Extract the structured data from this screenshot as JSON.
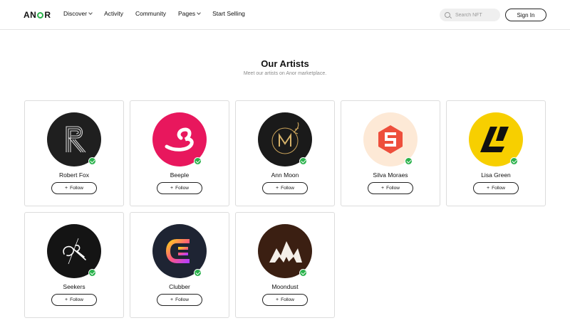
{
  "header": {
    "logo_text_pre": "AN",
    "logo_text_post": "R",
    "nav": [
      {
        "label": "Discover",
        "has_dropdown": true
      },
      {
        "label": "Activity",
        "has_dropdown": false
      },
      {
        "label": "Community",
        "has_dropdown": false
      },
      {
        "label": "Pages",
        "has_dropdown": true
      },
      {
        "label": "Start Selling",
        "has_dropdown": false
      }
    ],
    "search_placeholder": "Search NFT",
    "signin_label": "Sign In",
    "accent_color": "#2bb24c"
  },
  "section": {
    "title": "Our Artists",
    "subtitle": "Meet our artists on Anor marketplace."
  },
  "follow_label": "Follow",
  "artists": [
    {
      "name": "Robert Fox",
      "avatar_icon": "striped-r-logo-icon",
      "avatar_bg": "#1f1f1f",
      "verified": true
    },
    {
      "name": "Beeple",
      "avatar_icon": "beeple-b-logo-icon",
      "avatar_bg": "#e8175d",
      "verified": true
    },
    {
      "name": "Ann Moon",
      "avatar_icon": "golden-m-monogram-icon",
      "avatar_bg": "#1a1a1a",
      "verified": true
    },
    {
      "name": "Silva Moraes",
      "avatar_icon": "hexagon-s-logo-icon",
      "avatar_bg": "#fde9d6",
      "verified": true
    },
    {
      "name": "Lisa Green",
      "avatar_icon": "geometric-l-logo-icon",
      "avatar_bg": "#f7cf00",
      "verified": true
    },
    {
      "name": "Seekers",
      "avatar_icon": "script-signature-logo-icon",
      "avatar_bg": "#141414",
      "verified": true
    },
    {
      "name": "Clubber",
      "avatar_icon": "gradient-c-logo-icon",
      "avatar_bg": "#1e2433",
      "verified": true
    },
    {
      "name": "Moondust",
      "avatar_icon": "mountain-m-logo-icon",
      "avatar_bg": "#3b1f12",
      "verified": true
    }
  ]
}
